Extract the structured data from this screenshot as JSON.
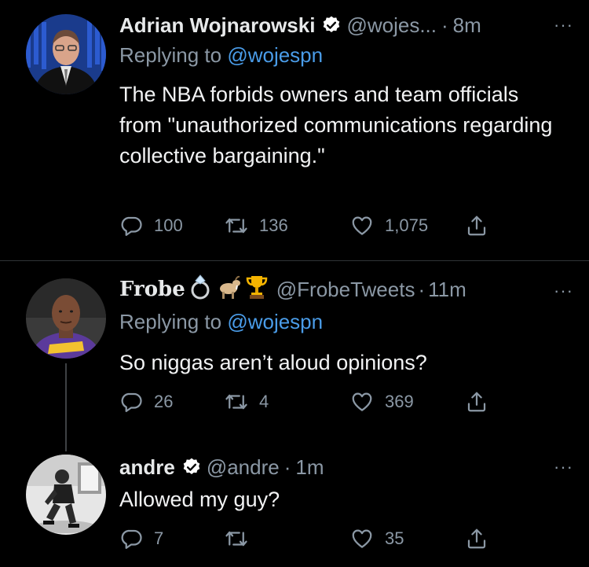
{
  "tweets": [
    {
      "name": "Adrian Wojnarowski",
      "verified": true,
      "handle": "@wojes...",
      "sep": "·",
      "time": "8m",
      "replying_prefix": "Replying to",
      "replying_to": "@wojespn",
      "text": "The NBA forbids owners and team officials from \"unauthorized communications regarding collective bargaining.\"",
      "replies": "100",
      "retweets": "136",
      "likes": "1,075"
    },
    {
      "name": "Frobe",
      "name_emojis": [
        "ring",
        "goat",
        "trophy"
      ],
      "handle": "@FrobeTweets",
      "sep": "·",
      "time": "11m",
      "replying_prefix": "Replying to",
      "replying_to": "@wojespn",
      "text": "So niggas aren’t aloud opinions?",
      "replies": "26",
      "retweets": "4",
      "likes": "369"
    },
    {
      "name": "andre",
      "verified": true,
      "handle": "@andre",
      "sep": "·",
      "time": "1m",
      "text": "Allowed my guy?",
      "replies": "7",
      "retweets": "",
      "likes": "35"
    }
  ],
  "more_glyph": "···",
  "colors": {
    "background": "#000000",
    "muted": "#8b98a5",
    "link": "#4a9ce8",
    "verified": "#ffffff"
  },
  "icons": [
    "reply-icon",
    "retweet-icon",
    "like-icon",
    "share-icon",
    "verified-icon",
    "more-icon"
  ]
}
